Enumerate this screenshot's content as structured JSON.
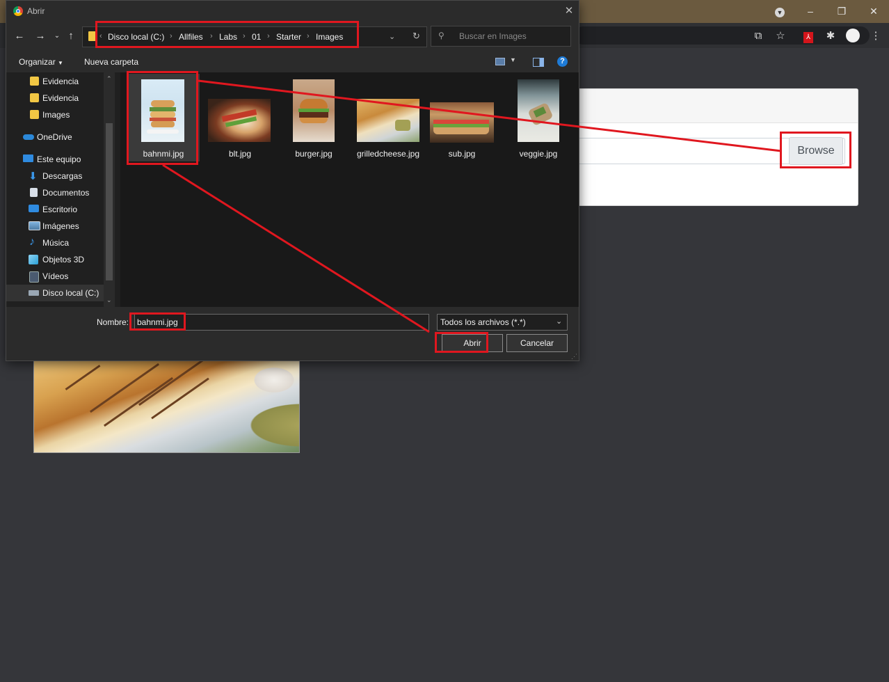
{
  "dialog": {
    "title": "Abrir",
    "breadcrumb": [
      "Disco local (C:)",
      "Allfiles",
      "Labs",
      "01",
      "Starter",
      "Images"
    ],
    "search_placeholder": "Buscar en Images",
    "organize_label": "Organizar",
    "new_folder_label": "Nueva carpeta",
    "nav_items": [
      {
        "label": "Evidencia",
        "icon": "folder-icon"
      },
      {
        "label": "Evidencia",
        "icon": "folder-icon"
      },
      {
        "label": "Images",
        "icon": "folder-icon"
      },
      {
        "label": "OneDrive",
        "icon": "cloud-icon"
      },
      {
        "label": "Este equipo",
        "icon": "computer-icon"
      },
      {
        "label": "Descargas",
        "icon": "download-icon"
      },
      {
        "label": "Documentos",
        "icon": "document-icon"
      },
      {
        "label": "Escritorio",
        "icon": "desktop-icon"
      },
      {
        "label": "Imágenes",
        "icon": "pictures-icon"
      },
      {
        "label": "Música",
        "icon": "music-icon"
      },
      {
        "label": "Objetos 3D",
        "icon": "cube-icon"
      },
      {
        "label": "Vídeos",
        "icon": "video-icon"
      },
      {
        "label": "Disco local (C:)",
        "icon": "drive-icon"
      }
    ],
    "files": [
      {
        "name": "bahnmi.jpg"
      },
      {
        "name": "blt.jpg"
      },
      {
        "name": "burger.jpg"
      },
      {
        "name": "grilledcheese.jpg"
      },
      {
        "name": "sub.jpg"
      },
      {
        "name": "veggie.jpg"
      }
    ],
    "filename_label": "Nombre:",
    "filename_value": "bahnmi.jpg",
    "filter_value": "Todos los archivos (*.*)",
    "open_label": "Abrir",
    "cancel_label": "Cancelar"
  },
  "page": {
    "browse_label": "Browse"
  },
  "annotation_color": "#e0171f"
}
